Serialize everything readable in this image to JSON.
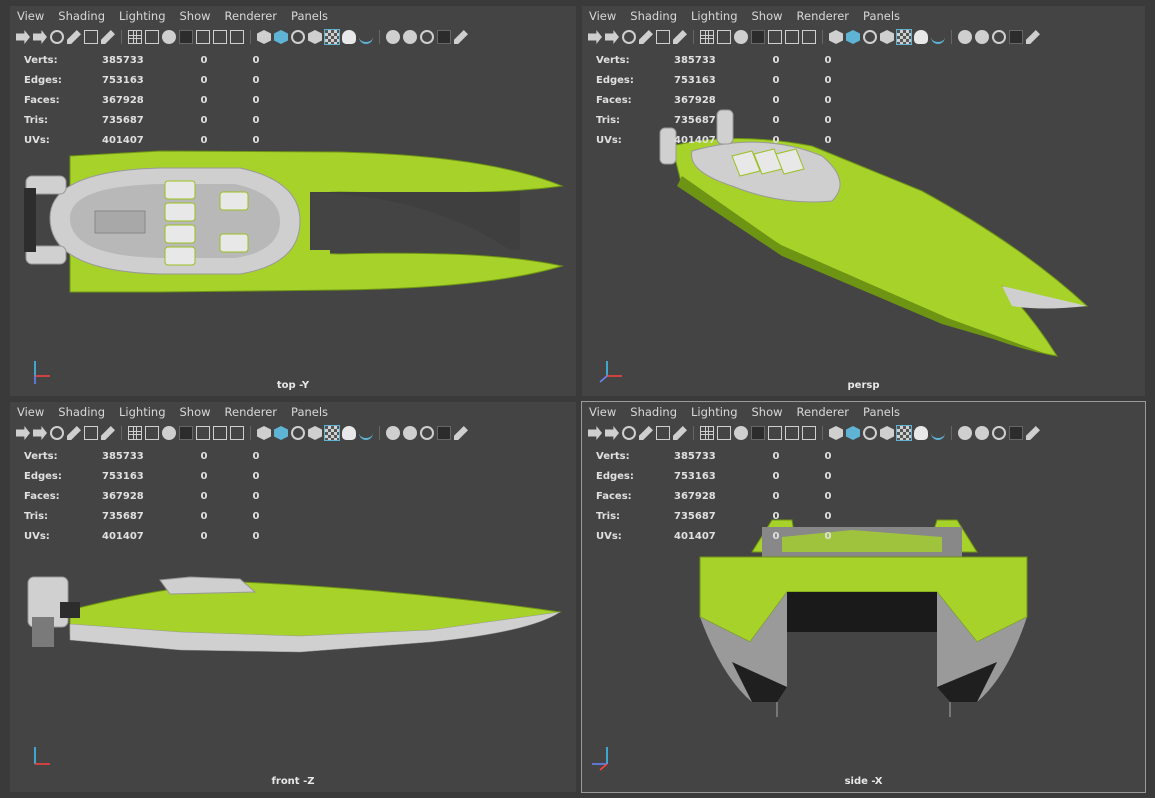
{
  "menu": [
    "View",
    "Shading",
    "Lighting",
    "Show",
    "Renderer",
    "Panels"
  ],
  "colors": {
    "viewport_bg": "#444444",
    "hull_green": "#a6d22a",
    "hull_green_dark": "#6e9414",
    "hull_white": "#d9d9d9",
    "accent_blue": "#5fb4d6"
  },
  "stats_labels": [
    "Verts:",
    "Edges:",
    "Faces:",
    "Tris:",
    "UVs:"
  ],
  "viewports": [
    {
      "label": "top -Y",
      "stats": [
        [
          "385733",
          "0",
          "0"
        ],
        [
          "753163",
          "0",
          "0"
        ],
        [
          "367928",
          "0",
          "0"
        ],
        [
          "735687",
          "0",
          "0"
        ],
        [
          "401407",
          "0",
          "0"
        ]
      ]
    },
    {
      "label": "persp",
      "stats": [
        [
          "385733",
          "0",
          "0"
        ],
        [
          "753163",
          "0",
          "0"
        ],
        [
          "367928",
          "0",
          "0"
        ],
        [
          "735687",
          "0",
          "0"
        ],
        [
          "401407",
          "0",
          "0"
        ]
      ]
    },
    {
      "label": "front -Z",
      "stats": [
        [
          "385733",
          "0",
          "0"
        ],
        [
          "753163",
          "0",
          "0"
        ],
        [
          "367928",
          "0",
          "0"
        ],
        [
          "735687",
          "0",
          "0"
        ],
        [
          "401407",
          "0",
          "0"
        ]
      ]
    },
    {
      "label": "side -X",
      "stats": [
        [
          "385733",
          "0",
          "0"
        ],
        [
          "753163",
          "0",
          "0"
        ],
        [
          "367928",
          "0",
          "0"
        ],
        [
          "735687",
          "0",
          "0"
        ],
        [
          "401407",
          "0",
          "0"
        ]
      ]
    }
  ]
}
